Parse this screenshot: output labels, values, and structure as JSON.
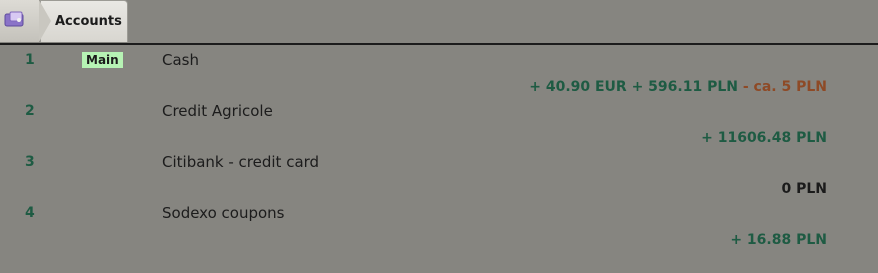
{
  "app": {
    "tab_label": "Accounts",
    "home_icon": "wallet-icon"
  },
  "accounts": [
    {
      "index": "1",
      "badge": "Main",
      "name": "Cash",
      "balance_parts": [
        "+ 40.90 EUR + 596.11 PLN",
        " - ca. 5 PLN"
      ]
    },
    {
      "index": "2",
      "name": "Credit Agricole",
      "balance": "+ 11606.48 PLN"
    },
    {
      "index": "3",
      "name": "Citibank - credit card",
      "balance": "0 PLN"
    },
    {
      "index": "4",
      "name": "Sodexo coupons",
      "balance": "+ 16.88 PLN"
    }
  ],
  "colors": {
    "positive": "#1e5b43",
    "negative": "#8e4a26",
    "neutral": "#1b1b1b",
    "badge_bg": "#b6f3b4"
  }
}
